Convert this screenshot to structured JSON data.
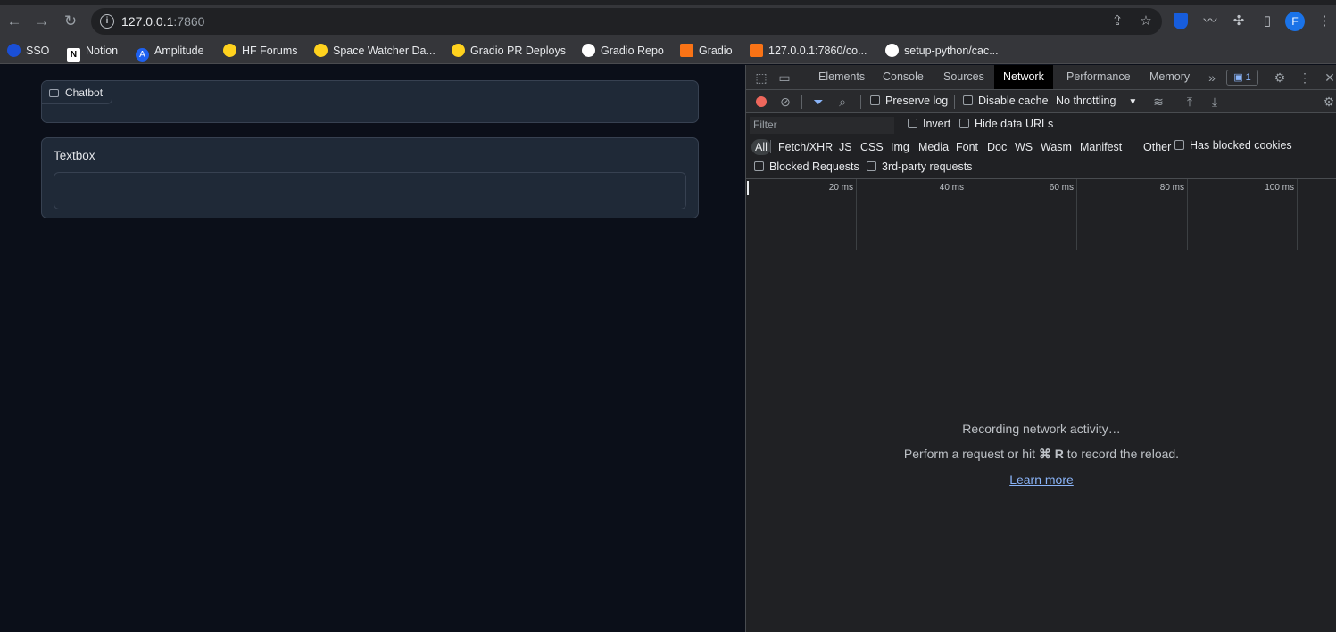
{
  "browser": {
    "url_host": "127.0.0.1",
    "url_port": ":7860",
    "avatar_letter": "F"
  },
  "bookmarks": [
    {
      "label": "SSO",
      "icon": "sso-icon",
      "color": "#1a4fd6"
    },
    {
      "label": "Notion",
      "icon": "notion-icon",
      "color": "#ffffff"
    },
    {
      "label": "Amplitude",
      "icon": "amplitude-icon",
      "color": "#1e61f0"
    },
    {
      "label": "HF Forums",
      "icon": "hugging-face-icon",
      "color": "#ffd21e"
    },
    {
      "label": "Space Watcher Da...",
      "icon": "hugging-face-icon",
      "color": "#ffd21e"
    },
    {
      "label": "Gradio PR Deploys",
      "icon": "hugging-face-icon",
      "color": "#ffd21e"
    },
    {
      "label": "Gradio Repo",
      "icon": "github-icon",
      "color": "#ffffff"
    },
    {
      "label": "Gradio",
      "icon": "gradio-icon",
      "color": "#f97316"
    },
    {
      "label": "127.0.0.1:7860/co...",
      "icon": "gradio-icon",
      "color": "#f97316"
    },
    {
      "label": "setup-python/cac...",
      "icon": "github-icon",
      "color": "#ffffff"
    }
  ],
  "app": {
    "chatbot_label": "Chatbot",
    "textbox_label": "Textbox",
    "textbox_value": ""
  },
  "devtools": {
    "tabs": [
      "Elements",
      "Console",
      "Sources",
      "Network",
      "Performance",
      "Memory"
    ],
    "active_tab": "Network",
    "issues_count": "1",
    "preserve_log": "Preserve log",
    "disable_cache": "Disable cache",
    "throttling": "No throttling",
    "filter_placeholder": "Filter",
    "invert": "Invert",
    "hide_data_urls": "Hide data URLs",
    "types": [
      "All",
      "Fetch/XHR",
      "JS",
      "CSS",
      "Img",
      "Media",
      "Font",
      "Doc",
      "WS",
      "Wasm",
      "Manifest",
      "Other"
    ],
    "has_blocked_cookies": "Has blocked cookies",
    "blocked_requests": "Blocked Requests",
    "third_party": "3rd-party requests",
    "timeline_ticks": [
      "20 ms",
      "40 ms",
      "60 ms",
      "80 ms",
      "100 ms"
    ],
    "empty_title": "Recording network activity…",
    "empty_hint_pre": "Perform a request or hit ",
    "empty_hint_key": "⌘ R",
    "empty_hint_post": " to record the reload.",
    "learn_more": "Learn more"
  }
}
